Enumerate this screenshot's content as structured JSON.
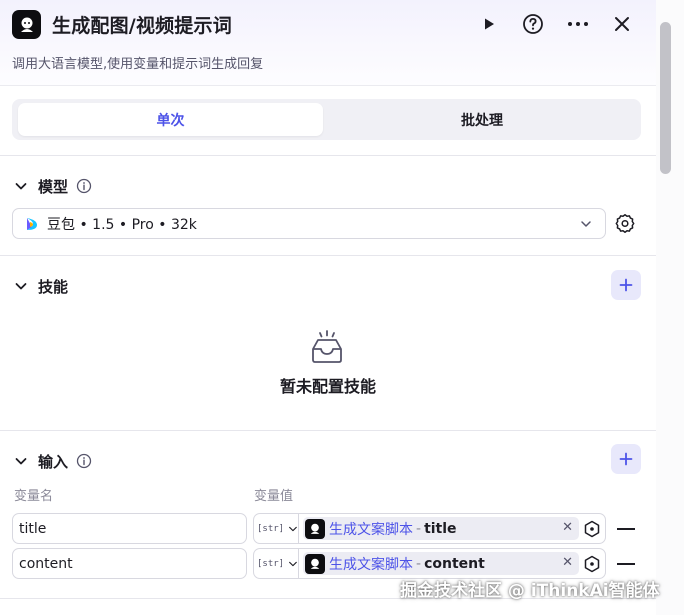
{
  "header": {
    "title": "生成配图/视频提示词",
    "subtitle": "调用大语言模型,使用变量和提示词生成回复"
  },
  "tabs": [
    {
      "label": "单次",
      "active": true
    },
    {
      "label": "批处理",
      "active": false
    }
  ],
  "model_section": {
    "title": "模型",
    "selected_model": "豆包 • 1.5 • Pro • 32k"
  },
  "skills_section": {
    "title": "技能",
    "empty_text": "暂未配置技能"
  },
  "input_section": {
    "title": "输入",
    "col_name_label": "变量名",
    "col_value_label": "变量值",
    "rows": [
      {
        "name": "title",
        "type": "[str]",
        "source": "生成文案脚本",
        "separator": "-",
        "variable": "title"
      },
      {
        "name": "content",
        "type": "[str]",
        "source": "生成文案脚本",
        "separator": "-",
        "variable": "content"
      }
    ]
  },
  "watermark": "掘金技术社区 @ iThinkAi智能体",
  "colors": {
    "accent": "#4d53e8",
    "tag_bg": "#ececf3",
    "plus_bg": "#e8e8fb"
  }
}
